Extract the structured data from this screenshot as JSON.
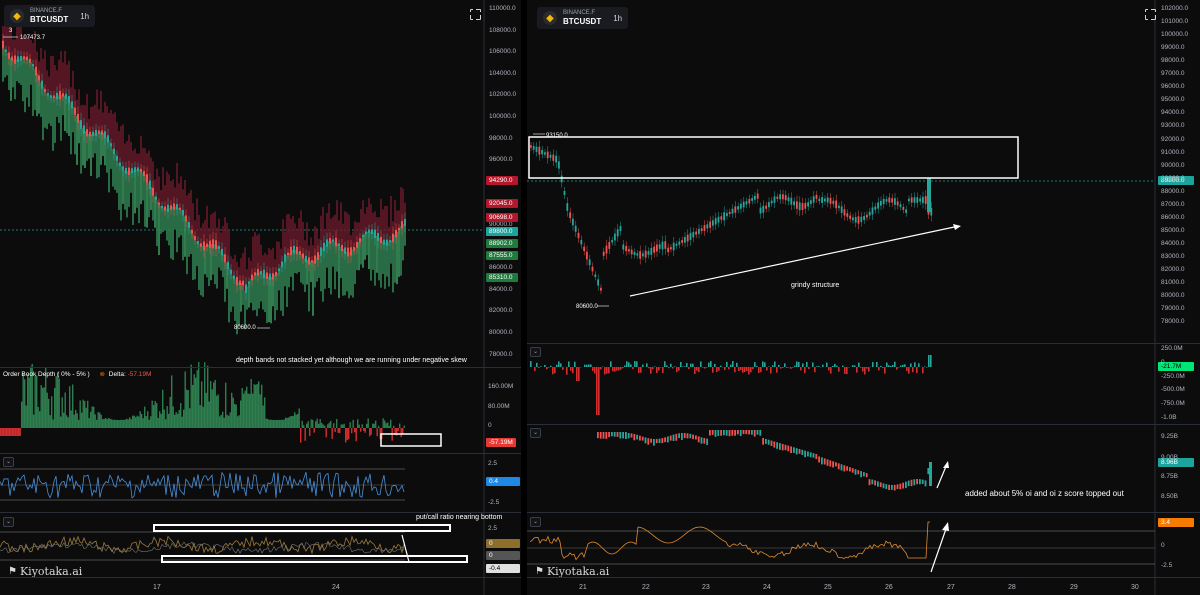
{
  "left_panel": {
    "exchange": "BINANCE.F",
    "symbol": "BTCUSDT",
    "timeframe": "1h",
    "top_left_value": "107473.7",
    "top_left_counter": "3",
    "y_axis": [
      "110000.0",
      "108000.0",
      "106000.0",
      "104000.0",
      "102000.0",
      "100000.0",
      "98000.0",
      "96000.0",
      "94000.0",
      "92000.0",
      "90000.0",
      "88000.0",
      "86000.0",
      "84000.0",
      "82000.0",
      "80000.0",
      "78000.0"
    ],
    "price_tags": [
      {
        "text": "94290.0",
        "color": "#b2182b"
      },
      {
        "text": "92045.0",
        "color": "#b2182b"
      },
      {
        "text": "90698.0",
        "color": "#b2182b"
      },
      {
        "text": "89800.0",
        "color": "#1ba39c"
      },
      {
        "text": "88902.0",
        "color": "#1e7b3c"
      },
      {
        "text": "87555.0",
        "color": "#1e7b3c"
      },
      {
        "text": "85310.0",
        "color": "#1e7b3c"
      }
    ],
    "low_label": "80600.0",
    "note_depth": "depth bands not stacked yet although we are running under negative skew",
    "orderbook_title": "Order Book Depth ( 0% - 5% )",
    "orderbook_delta_label": "Delta:",
    "orderbook_delta_value": "-57.19M",
    "orderbook_axis": [
      "160.00M",
      "80.00M",
      "0"
    ],
    "orderbook_tag": "-57.19M",
    "osc_axis": [
      "2.5",
      "-2.5"
    ],
    "osc_tag": "0.4",
    "putcall_note": "put/call ratio nearing bottom",
    "putcall_axis": [
      "2.5"
    ],
    "putcall_tags": [
      "0",
      "0",
      "-0.4"
    ],
    "x_axis": [
      "17",
      "24"
    ],
    "watermark": "Kiyotaka.ai"
  },
  "right_panel": {
    "exchange": "BINANCE.F",
    "symbol": "BTCUSDT",
    "timeframe": "1h",
    "y_axis": [
      "102000.0",
      "101000.0",
      "100000.0",
      "99000.0",
      "98000.0",
      "97000.0",
      "96000.0",
      "95000.0",
      "94000.0",
      "93000.0",
      "92000.0",
      "91000.0",
      "90000.0",
      "89000.0",
      "88000.0",
      "87000.0",
      "86000.0",
      "85000.0",
      "84000.0",
      "83000.0",
      "82000.0",
      "81000.0",
      "80000.0",
      "79000.0",
      "78000.0"
    ],
    "current_price_tag": "89800.0",
    "high_label": "93150.0",
    "low_label": "80600.0",
    "note_grindy": "grindy structure",
    "delta_axis": [
      "250.0M",
      "0",
      "-250.0M",
      "-500.0M",
      "-750.0M",
      "-1.0B"
    ],
    "delta_tag": "-21.7M",
    "oi_axis": [
      "9.25B",
      "9.00B",
      "8.75B",
      "8.50B"
    ],
    "oi_tag": "8.96B",
    "oi_note": "added about 5% oi and oi z score topped out",
    "z_axis": [
      "2.5",
      "0",
      "-2.5"
    ],
    "z_tag": "3.4",
    "x_axis": [
      "21",
      "22",
      "23",
      "24",
      "25",
      "26",
      "27",
      "28",
      "29",
      "30"
    ],
    "watermark": "Kiyotaka.ai"
  }
}
